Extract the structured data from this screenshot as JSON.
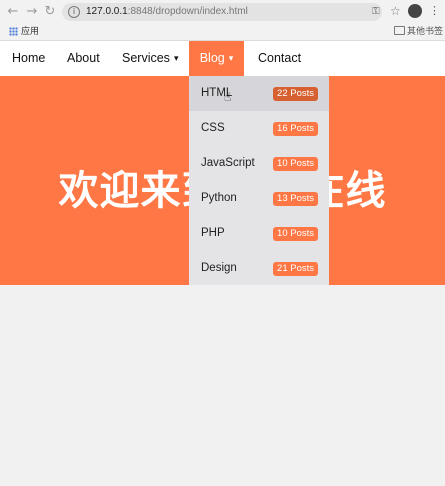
{
  "browser": {
    "url_host": "127.0.0.1",
    "url_port_path": ":8848/dropdown/index.html",
    "watermark": "光",
    "apps_label": "应用",
    "bookmarks_label": "其他书签"
  },
  "nav": {
    "items": [
      {
        "label": "Home"
      },
      {
        "label": "About"
      },
      {
        "label": "Services",
        "caret": "▾"
      },
      {
        "label": "Blog",
        "caret": "▾"
      },
      {
        "label": "Contact"
      }
    ]
  },
  "hero": {
    "title": "欢迎来到光光在线"
  },
  "dropdown": {
    "items": [
      {
        "label": "HTML",
        "badge": "22 Posts"
      },
      {
        "label": "CSS",
        "badge": "16 Posts"
      },
      {
        "label": "JavaScript",
        "badge": "10 Posts"
      },
      {
        "label": "Python",
        "badge": "13 Posts"
      },
      {
        "label": "PHP",
        "badge": "10 Posts"
      },
      {
        "label": "Design",
        "badge": "21 Posts"
      }
    ]
  },
  "colors": {
    "accent": "#ff7744",
    "dropdown_bg": "#e4e3e6",
    "page_bg": "#f1f1f1"
  }
}
